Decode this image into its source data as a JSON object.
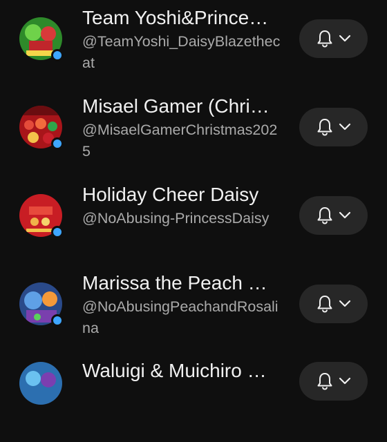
{
  "subscriptions": [
    {
      "title": "Team Yoshi&Prince…",
      "handle": "@TeamYoshi_DaisyBlazethecat",
      "avatar_icon": "christmas-yoshi-avatar"
    },
    {
      "title": "Misael Gamer (Chri…",
      "handle": "@MisaelGamerChristmas2025",
      "avatar_icon": "christmas-crowd-avatar"
    },
    {
      "title": "Holiday Cheer Daisy",
      "handle": "@NoAbusing-PrincessDaisy",
      "avatar_icon": "holiday-daisy-avatar"
    },
    {
      "title": "Marissa the Peach …",
      "handle": "@NoAbusingPeachandRosalina",
      "avatar_icon": "peach-rosalina-avatar"
    },
    {
      "title": "Waluigi & Muichiro …",
      "handle": "",
      "avatar_icon": "waluigi-avatar"
    }
  ],
  "colors": {
    "background": "#0f0f0f",
    "button": "#272727",
    "live_dot": "#3ea6ff",
    "secondary_text": "#aaaaaa"
  }
}
